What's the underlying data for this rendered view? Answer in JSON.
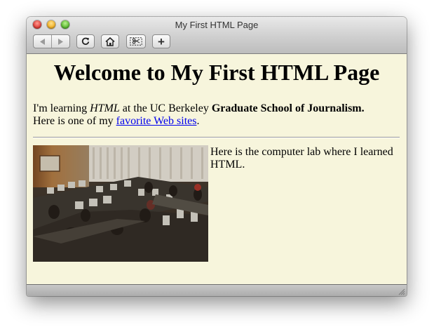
{
  "window": {
    "title": "My First HTML Page"
  },
  "toolbar": {
    "back_icon": "back-arrow-icon",
    "forward_icon": "forward-arrow-icon",
    "reload_icon": "reload-icon",
    "home_icon": "home-icon",
    "snip_icon": "snip-icon",
    "add_label": "+"
  },
  "page": {
    "heading": "Welcome to My First HTML Page",
    "line1_prefix": "I'm learning ",
    "line1_em": "HTML",
    "line1_mid": " at the UC Berkeley ",
    "line1_strong": "Graduate School of Journalism.",
    "line2_prefix": "Here is one of my ",
    "line2_link": "favorite Web sites",
    "line2_suffix": ".",
    "caption": "Here is the computer lab where I learned HTML."
  },
  "colors": {
    "page_background": "#f7f5dc",
    "link": "#0000ee"
  }
}
